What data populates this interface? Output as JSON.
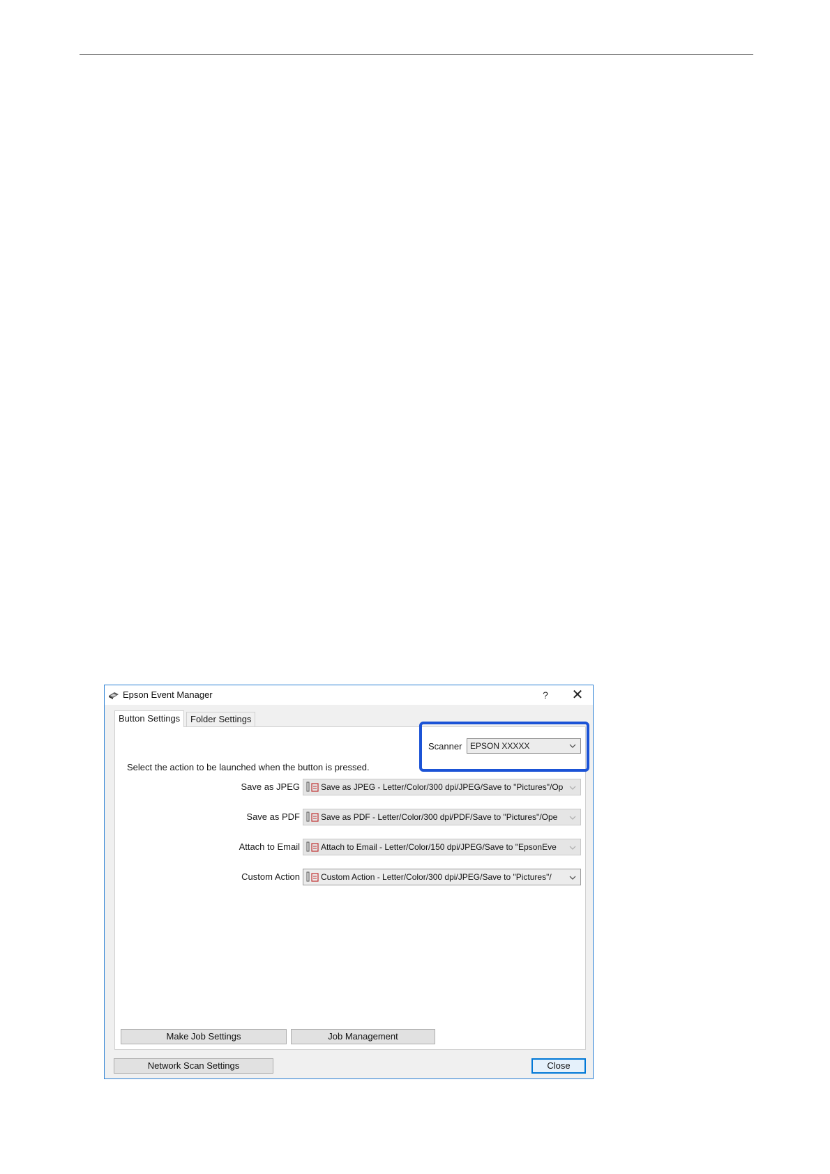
{
  "window": {
    "title": "Epson Event Manager",
    "help_label": "?",
    "close_glyph": "✕"
  },
  "tabs": [
    {
      "label": "Button Settings",
      "active": true
    },
    {
      "label": "Folder Settings",
      "active": false
    }
  ],
  "scanner": {
    "label": "Scanner",
    "value": "EPSON XXXXX",
    "highlight_color": "#1b53d6"
  },
  "instruction": "Select the action to be launched when the button is pressed.",
  "actions": [
    {
      "label": "Save as JPEG",
      "value": "Save as JPEG - Letter/Color/300 dpi/JPEG/Save to \"Pictures\"/Op",
      "enabled": false
    },
    {
      "label": "Save as PDF",
      "value": "Save as PDF - Letter/Color/300 dpi/PDF/Save to \"Pictures\"/Ope",
      "enabled": false
    },
    {
      "label": "Attach to Email",
      "value": "Attach to Email - Letter/Color/150 dpi/JPEG/Save to \"EpsonEve",
      "enabled": false
    },
    {
      "label": "Custom Action",
      "value": "Custom Action - Letter/Color/300 dpi/JPEG/Save to \"Pictures\"/",
      "enabled": true
    }
  ],
  "buttons": {
    "make_job_settings": "Make Job Settings",
    "job_management": "Job Management",
    "network_scan_settings": "Network Scan Settings",
    "close": "Close"
  },
  "colors": {
    "window_border": "#2a7fd4",
    "close_button_border": "#0078d7"
  }
}
